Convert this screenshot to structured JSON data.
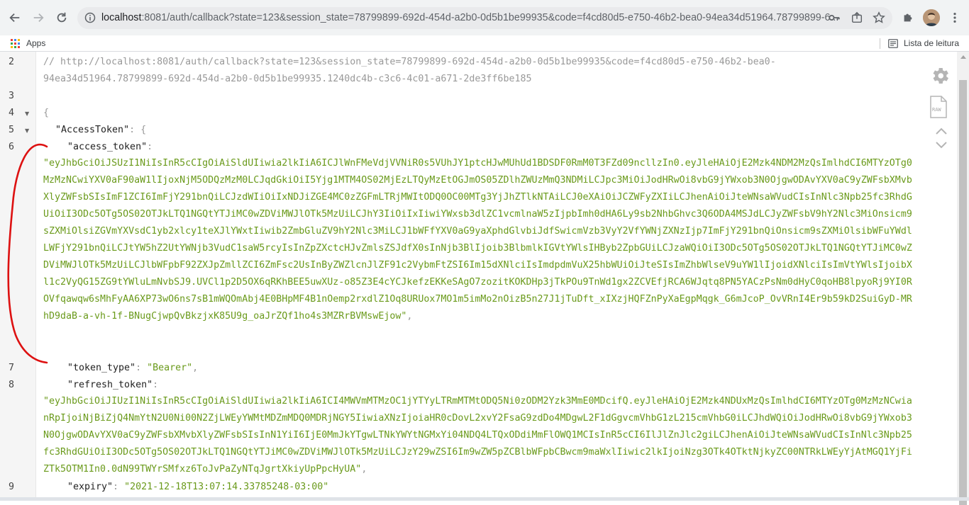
{
  "browser": {
    "url_host": "localhost",
    "url_rest": ":8081/auth/callback?state=123&session_state=78799899-692d-454d-a2b0-0d5b1be99935&code=f4cd80d5-e750-46b2-bea0-94ea34d51964.78799899-6...",
    "bookmarks": {
      "apps_label": "Apps",
      "reading_list_label": "Lista de leitura"
    }
  },
  "viewer": {
    "line_numbers": [
      "2",
      "3",
      "4",
      "5",
      "6",
      "7",
      "8",
      "9"
    ],
    "comment_line1": "// http://localhost:8081/auth/callback?state=123&session_state=78799899-692d-454d-a2b0-0d5b1be99935&code=f4cd80d5-e750-46b2-bea0-",
    "comment_line2": "94ea34d51964.78799899-692d-454d-a2b0-0d5b1be99935.1240dc4b-c3c6-4c01-a671-2de3ff6be185",
    "open_brace": "{",
    "access_token_obj_key": "\"AccessToken\"",
    "colon_brace": ": {",
    "colon": ":",
    "comma": ",",
    "access_token_key": "\"access_token\"",
    "access_token_value": "\"eyJhbGciOiJSUzI1NiIsInR5cCIgOiAiSldUIiwia2lkIiA6ICJlWnFMeVdjVVNiR0s5VUhJY1ptcHJwMUhUd1BDSDF0RmM0T3FZd09ncllzIn0.eyJleHAiOjE2Mzk4NDM2MzQsImlhdCI6MTYzOTg0MzMzNCwiYXV0aF90aW1lIjoxNjM5ODQzMzM0LCJqdGkiOiI5Yjg1MTM4OS02MjEzLTQyMzEtOGJmOS05ZDlhZWUzMmQ3NDMiLCJpc3MiOiJodHRwOi8vbG9jYWxob3N0OjgwODAvYXV0aC9yZWFsbXMvbXlyZWFsbSIsImF1ZCI6ImFjY291bnQiLCJzdWIiOiIxNDJiZGE4MC0zZGFmLTRjMWItODQ0OC00MTg3YjJhZTlkNTAiLCJ0eXAiOiJCZWFyZXIiLCJhenAiOiJteWNsaWVudCIsInNlc3Npb25fc3RhdGUiOiI3ODc5OTg5OS02OTJkLTQ1NGQtYTJiMC0wZDViMWJlOTk5MzUiLCJhY3IiOiIxIiwiYWxsb3dlZC1vcmlnaW5zIjpbImh0dHA6Ly9sb2NhbGhvc3Q6ODA4MSJdLCJyZWFsbV9hY2Nlc3MiOnsicm9sZXMiOlsiZGVmYXVsdC1yb2xlcy1teXJlYWxtIiwib2ZmbGluZV9hY2Nlc3MiLCJ1bWFfYXV0aG9yaXphdGlvbiJdfSwicmVzb3VyY2VfYWNjZXNzIjp7ImFjY291bnQiOnsicm9sZXMiOlsibWFuYWdlLWFjY291bnQiLCJtYW5hZ2UtYWNjb3VudC1saW5rcyIsInZpZXctcHJvZmlsZSJdfX0sInNjb3BlIjoib3BlbmlkIGVtYWlsIHByb2ZpbGUiLCJzaWQiOiI3ODc5OTg5OS02OTJkLTQ1NGQtYTJiMC0wZDViMWJlOTk5MzUiLCJlbWFpbF92ZXJpZmllZCI6ZmFsc2UsInByZWZlcnJlZF91c2VybmFtZSI6Im15dXNlciIsImdpdmVuX25hbWUiOiJteSIsImZhbWlseV9uYW1lIjoidXNlciIsImVtYWlsIjoibXl1c2VyQG15ZG9tYWluLmNvbSJ9.UVCl1p2D5OX6qRKhBEE5uwXUz-o85Z3E4cYCJkefzEKKeSAgO7zozitKOKDHp3jTkPOu9TnWd1gx2ZCVEfjRCA6WJqtq8PN5YACzPsNm0dHyC0qoHB8lpyoRj9YI0ROVfqawqw6sMhFyAA6XP73wO6ns7sB1mWQOmAbj4E0BHpMF4B1nOemp2rxdlZ1Oq8URUox7MO1m5imMo2nOizB5n27J1jTuDft_xIXzjHQFZnPyXaEgpMqgk_G6mJcoP_OvVRnI4Er9b59kD2SuiGyD-MRhD9daB-a-vh-1f-BNugCjwpQvBkzjxK85U9g_oaJrZQf1ho4s3MZRrBVMswEjow\"",
    "token_type_key": "\"token_type\"",
    "token_type_value": "\"Bearer\"",
    "refresh_token_key": "\"refresh_token\"",
    "refresh_token_value": "\"eyJhbGciOiJIUzI1NiIsInR5cCIgOiAiSldUIiwia2lkIiA6ICI4MWVmMTMzOC1jYTYyLTRmMTMtODQ5Ni0zODM2Yzk3MmE0MDcifQ.eyJleHAiOjE2Mzk4NDUxMzQsImlhdCI6MTYzOTg0MzMzNCwianRpIjoiNjBiZjQ4NmYtN2U0Ni00N2ZjLWEyYWMtMDZmMDQ0MDRjNGY5IiwiaXNzIjoiaHR0cDovL2xvY2FsaG9zdDo4MDgwL2F1dGgvcmVhbG1zL215cmVhbG0iLCJhdWQiOiJodHRwOi8vbG9jYWxob3N0OjgwODAvYXV0aC9yZWFsbXMvbXlyZWFsbSIsInN1YiI6IjE0MmJkYTgwLTNkYWYtNGMxYi04NDQ4LTQxODdiMmFlOWQ1MCIsInR5cCI6IlJlZnJlc2giLCJhenAiOiJteWNsaWVudCIsInNlc3Npb25fc3RhdGUiOiI3ODc5OTg5OS02OTJkLTQ1NGQtYTJiMC0wZDViMWJlOTk5MzUiLCJzY29wZSI6Im9wZW5pZCBlbWFpbCBwcm9maWxlIiwic2lkIjoiNzg3OTk4OTktNjkyZC00NTRkLWEyYjAtMGQ1YjFiZTk5OTM1In0.0dN99TWYrSMfxz6ToJvPaZyNTqJgrtXkiyUpPpcHyUA\"",
    "expiry_key": "\"expiry\"",
    "expiry_value": "\"2021-12-18T13:07:14.33785248-03:00\"",
    "raw_label": "RAW"
  },
  "colors": {
    "string": "#6a9a1b",
    "annotation": "#dd1111"
  }
}
